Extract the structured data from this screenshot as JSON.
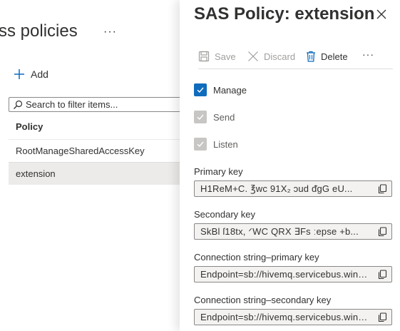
{
  "left": {
    "title": "ss policies",
    "more": "···",
    "add_label": "Add",
    "search_placeholder": "Search to filter items...",
    "column_header": "Policy",
    "rows": [
      "RootManageSharedAccessKey",
      "extension"
    ],
    "selected_row": "extension"
  },
  "panel": {
    "title": "SAS Policy: extension",
    "toolbar": {
      "save": "Save",
      "discard": "Discard",
      "delete": "Delete",
      "more": "···"
    },
    "claims": [
      {
        "label": "Manage",
        "checked": true
      },
      {
        "label": "Send",
        "checked": true,
        "disabled": true
      },
      {
        "label": "Listen",
        "checked": true,
        "disabled": true
      }
    ],
    "fields": [
      {
        "label": "Primary key",
        "value": "H1ReM+C.  ℥wc   91X₂  ɔud   ᵭgG  eU..."
      },
      {
        "label": "Secondary key",
        "value": "SkBl   ſ18tx,  ᐟWC   QRX   ∃Fs   ːepse  +b..."
      },
      {
        "label": "Connection string–primary key",
        "value": "Endpoint=sb://hivemq.servicebus.windo..."
      },
      {
        "label": "Connection string–secondary key",
        "value": "Endpoint=sb://hivemq.servicebus.windo..."
      }
    ]
  },
  "colors": {
    "accent": "#0f6cbd",
    "selected_row": "#edebe9",
    "field_bg": "#f3f2f1",
    "disabled_text": "#a19f9d"
  }
}
